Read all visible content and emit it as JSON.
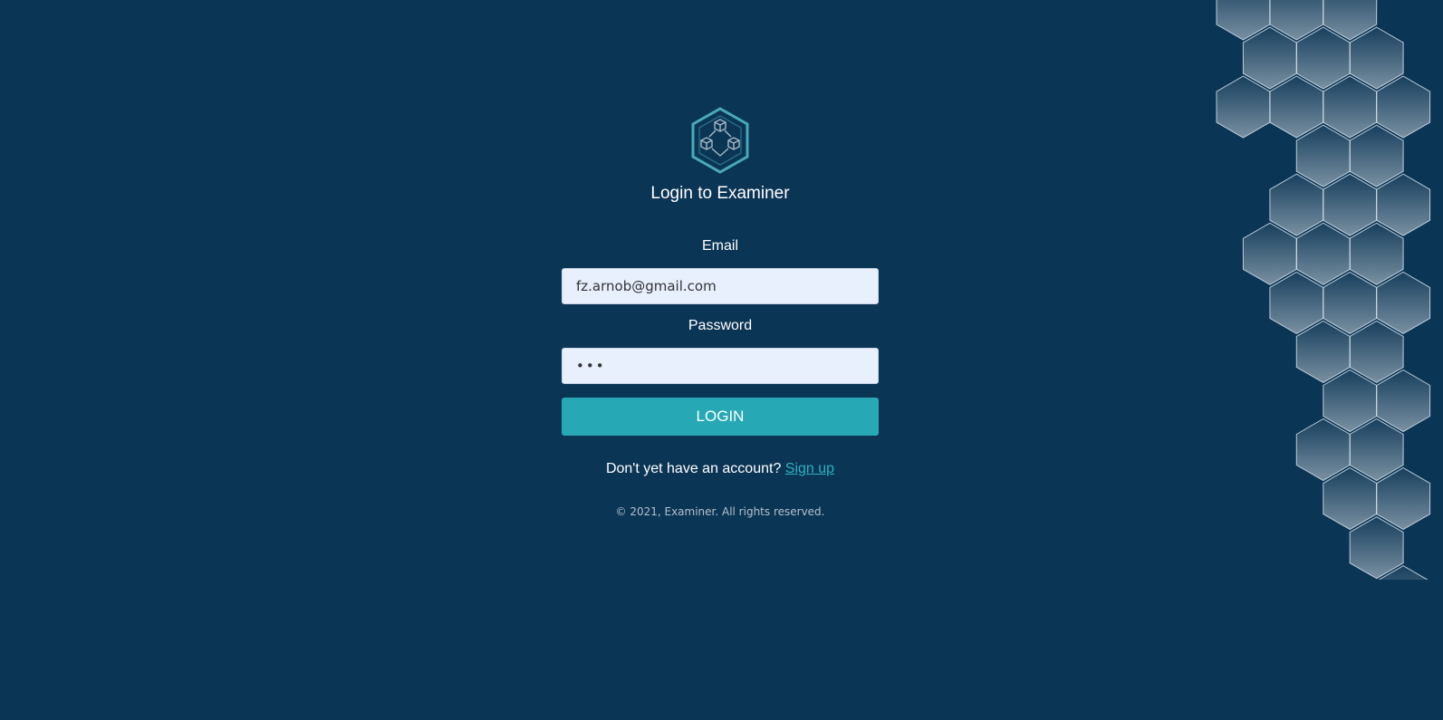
{
  "app": {
    "title": "Login to Examiner",
    "logo_icon": "network-cube-icon"
  },
  "form": {
    "email_label": "Email",
    "email_value": "fz.arnob@gmail.com",
    "password_label": "Password",
    "password_value": "•••",
    "login_label": "LOGIN"
  },
  "signup": {
    "prompt": "Don't yet have an account?",
    "link_label": "Sign up"
  },
  "footer": {
    "copyright": "© 2021, Examiner. All rights reserved."
  },
  "colors": {
    "background": "#0b3555",
    "accent": "#26a9b4",
    "link": "#29b4c0",
    "input_background": "#e8f0fe"
  }
}
